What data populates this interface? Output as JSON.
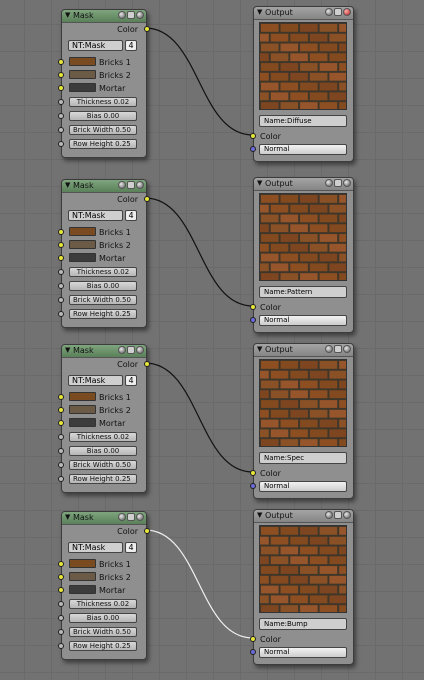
{
  "colors": {
    "brick": "#8d4f22",
    "mortar": "#3f362a",
    "bricks1": "#7a4a20",
    "bricks2": "#6a5a46",
    "mortarSwatch": "#3c3c3c"
  },
  "groups": [
    {
      "mask": {
        "title": "Mask",
        "color_label": "Color",
        "nt_label": "NT:Mask",
        "nt_count": "4",
        "bricks1": "Bricks 1",
        "bricks2": "Bricks 2",
        "mortar": "Mortar",
        "thickness": "Thickness 0.02",
        "bias": "Bias 0.00",
        "brick_width": "Brick Width 0.50",
        "row_height": "Row Height 0.25"
      },
      "output": {
        "title": "Output",
        "name": "Name:Diffuse",
        "color_label": "Color",
        "select": "Normal"
      }
    },
    {
      "mask": {
        "title": "Mask",
        "color_label": "Color",
        "nt_label": "NT:Mask",
        "nt_count": "4",
        "bricks1": "Bricks 1",
        "bricks2": "Bricks 2",
        "mortar": "Mortar",
        "thickness": "Thickness 0.02",
        "bias": "Bias 0.00",
        "brick_width": "Brick Width 0.50",
        "row_height": "Row Height 0.25"
      },
      "output": {
        "title": "Output",
        "name": "Name:Pattern",
        "color_label": "Color",
        "select": "Normal"
      }
    },
    {
      "mask": {
        "title": "Mask",
        "color_label": "Color",
        "nt_label": "NT:Mask",
        "nt_count": "4",
        "bricks1": "Bricks 1",
        "bricks2": "Bricks 2",
        "mortar": "Mortar",
        "thickness": "Thickness 0.02",
        "bias": "Bias 0.00",
        "brick_width": "Brick Width 0.50",
        "row_height": "Row Height 0.25"
      },
      "output": {
        "title": "Output",
        "name": "Name:Spec",
        "color_label": "Color",
        "select": "Normal"
      }
    },
    {
      "mask": {
        "title": "Mask",
        "color_label": "Color",
        "nt_label": "NT:Mask",
        "nt_count": "4",
        "bricks1": "Bricks 1",
        "bricks2": "Bricks 2",
        "mortar": "Mortar",
        "thickness": "Thickness 0.02",
        "bias": "Bias 0.00",
        "brick_width": "Brick Width 0.50",
        "row_height": "Row Height 0.25"
      },
      "output": {
        "title": "Output",
        "name": "Name:Bump",
        "color_label": "Color",
        "select": "Normal"
      }
    }
  ]
}
